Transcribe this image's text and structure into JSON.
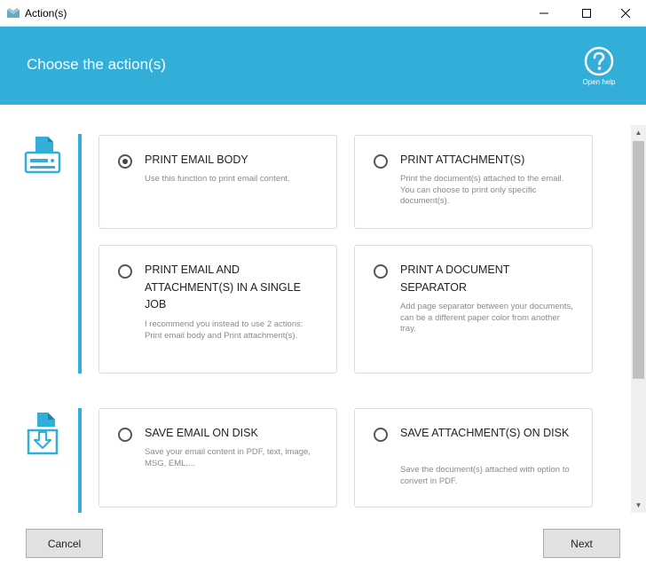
{
  "window": {
    "title": "Action(s)",
    "minimize_symbol": "—",
    "maximize_symbol": "☐",
    "close_symbol": "✕"
  },
  "header": {
    "title": "Choose the action(s)",
    "help_label": "Open help",
    "background_color": "#33aed8"
  },
  "groups": [
    {
      "icon": "printer-icon",
      "cards": [
        {
          "title": "PRINT EMAIL BODY",
          "description": "Use this function to print email content.",
          "selected": true
        },
        {
          "title": "PRINT ATTACHMENT(S)",
          "description": "Print the document(s) attached to the email. You can choose to print only specific document(s).",
          "selected": false
        },
        {
          "title": "PRINT EMAIL AND ATTACHMENT(S) IN A SINGLE JOB",
          "description": "I recommend you instead to use 2 actions: Print email body and Print attachment(s).",
          "selected": false
        },
        {
          "title": "PRINT A DOCUMENT SEPARATOR",
          "description": "Add page separator between your documents, can be a different paper color from another tray.",
          "selected": false
        }
      ]
    },
    {
      "icon": "save-to-disk-icon",
      "cards": [
        {
          "title": "SAVE EMAIL ON DISK",
          "description": "Save your email content in PDF, text, image, MSG, EML,...",
          "selected": false
        },
        {
          "title": "SAVE ATTACHMENT(S) ON DISK",
          "description": "Save the document(s) attached with option to convert in PDF.",
          "selected": false
        }
      ]
    }
  ],
  "footer": {
    "cancel_label": "Cancel",
    "next_label": "Next"
  }
}
